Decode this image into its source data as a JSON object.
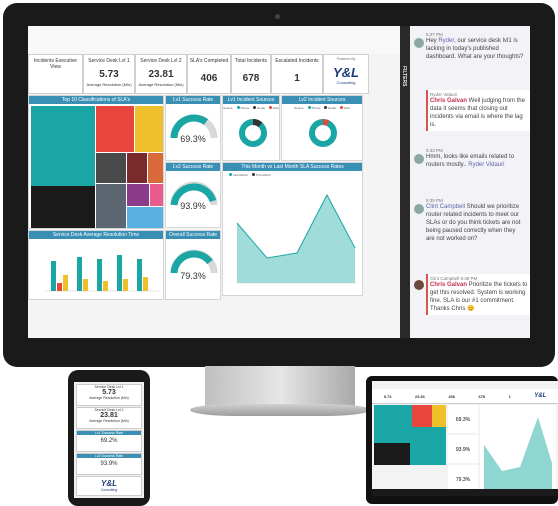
{
  "dashboard": {
    "kpis": [
      {
        "title": "Incidents Executive View",
        "value": "",
        "sub": ""
      },
      {
        "title": "Service Desk Lvl 1",
        "value": "5.73",
        "sub": "Average Resolution (Min)"
      },
      {
        "title": "Service Desk Lvl 2",
        "value": "23.81",
        "sub": "Average Resolution (Min)"
      },
      {
        "title": "SLA's Completed",
        "value": "406",
        "sub": ""
      },
      {
        "title": "Total Incidents",
        "value": "678",
        "sub": ""
      },
      {
        "title": "Escalated Incidents",
        "value": "1",
        "sub": ""
      }
    ],
    "logo": {
      "main": "Y&L",
      "sub": "Consulting",
      "powered": "Powered By"
    },
    "panels": {
      "treemap_title": "Top 10 Classifications of SLA's",
      "lv1_success": "Lv1 Success Rate",
      "lv1_sources": "Lv1 Incident Sources",
      "lv2_sources": "Lv2 Incident Sources",
      "lv2_success": "Lv2 Success Rate",
      "month_sla": "This Month vs Last Month SLA Success Rates",
      "avg_resolution": "Service Desk Average Resolution Time",
      "overall": "Overall Success Rate"
    },
    "gauges": {
      "lv1": "69.3%",
      "lv2": "93.9%",
      "overall": "79.3%"
    },
    "source_legend": [
      "Source",
      "Phone",
      "Email",
      "Web"
    ],
    "line_legend": [
      "Last Month",
      "This Month"
    ],
    "filters_label": "FILTERS",
    "colors": {
      "teal": "#1ba6a6",
      "header": "#3a8fb5",
      "red": "#e8453c",
      "yellow": "#f0c02b",
      "purple": "#8c3a8c",
      "green": "#3fb34f"
    }
  },
  "chat": {
    "messages": [
      {
        "time": "5:27 PM",
        "sender": "",
        "pre": "Hey ",
        "mention": "Ryder",
        "post": ", our service desk lvl1 is lacking in today's published dashboard. What are your thoughts?"
      },
      {
        "time": "5:31 PM",
        "sender": "Ryder Vidauri",
        "pre": "",
        "mention": "Chris Galvan",
        "post": " Well judging from the data it seems that closing out incidents via email is where the lag is."
      },
      {
        "time": "5:33 PM",
        "sender": "",
        "pre": "Hmm, looks like emails related to routers mostly.. ",
        "mention": "Ryder Vidauri",
        "post": ""
      },
      {
        "time": "5:35 PM",
        "sender": "",
        "pre": "",
        "mention": "Clint Campbell",
        "post": " Should we prioritize router related incidents to meet our SLAs or do you think tickets are not being paused correctly when they are not worked on?"
      },
      {
        "time": "5:39 PM",
        "sender": "Clint Campbell",
        "pre": "",
        "mention": "Chris Galvan",
        "post": " Prioritize the tickets to get this resolved. System is working fine. SLA is our #1 commitment. Thanks Chris 😊"
      }
    ]
  },
  "phone": {
    "cards": [
      {
        "title": "Service Desk Lvl 1",
        "value": "5.73",
        "sub": "Average Resolution (Min)"
      },
      {
        "title": "Service Desk Lvl 2",
        "value": "23.81",
        "sub": "Average Resolution (Min)"
      },
      {
        "title": "Lv1 Success Rate",
        "value": "69.2%",
        "sub": ""
      },
      {
        "title": "Lv2 Success Rate",
        "value": "93.9%",
        "sub": ""
      }
    ],
    "logo": "Y&L",
    "logo_sub": "Consulting"
  },
  "tablet": {
    "kpis": [
      "5.73",
      "23.81",
      "406",
      "678",
      "1"
    ],
    "logo": "Y&L",
    "gauges": [
      "69.3%",
      "93.9%",
      "79.3%"
    ]
  }
}
